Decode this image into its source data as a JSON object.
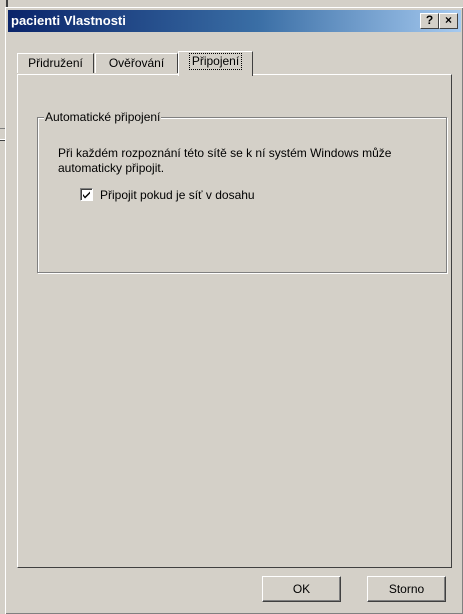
{
  "window": {
    "title": "pacienti Vlastnosti",
    "help_button": "?",
    "close_button": "×"
  },
  "tabs": [
    {
      "label": "Přidružení",
      "active": false
    },
    {
      "label": "Ověřování",
      "active": false
    },
    {
      "label": "Připojení",
      "active": true
    }
  ],
  "group": {
    "label": "Automatické připojení",
    "description": "Při každém rozpoznání této sítě se k ní systém Windows může automaticky připojit.",
    "checkbox": {
      "label": "Připojit pokud je síť v dosahu",
      "checked": true
    }
  },
  "buttons": {
    "ok": "OK",
    "cancel": "Storno"
  },
  "colors": {
    "face": "#d4d0c8",
    "title_start": "#0a246a",
    "title_end": "#a6caf0"
  }
}
